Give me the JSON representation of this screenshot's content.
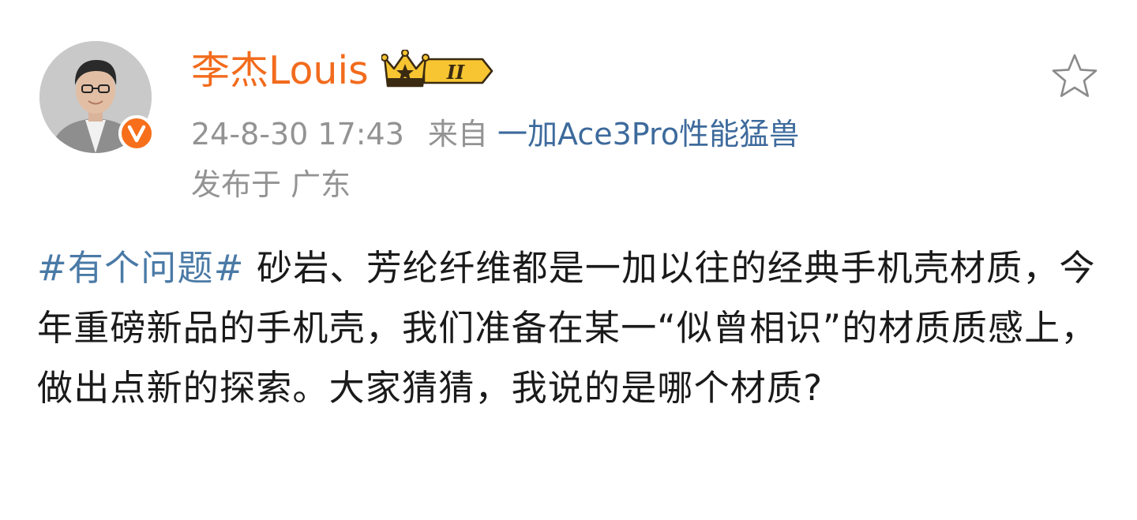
{
  "author": {
    "name": "李杰Louis",
    "vip_level": "II"
  },
  "meta": {
    "timestamp": "24-8-30 17:43",
    "from_label": "来自",
    "source": "一加Ace3Pro性能猛兽",
    "location": "发布于 广东"
  },
  "post": {
    "hashtag": "#有个问题#",
    "text": " 砂岩、芳纶纤维都是一加以往的经典手机壳材质，今年重磅新品的手机壳，我们准备在某一“似曾相识”的材质质感上，做出点新的探索。大家猜猜，我说的是哪个材质?"
  },
  "icons": {
    "verified": "verified-v-icon",
    "vip": "crown-vip-icon",
    "favorite": "star-icon"
  },
  "colors": {
    "username": "#f26b1d",
    "link": "#3d6a9c",
    "hashtag": "#4a7aa6",
    "meta": "#939393",
    "verified": "#f76f1b",
    "vip_gold": "#f6c531"
  }
}
